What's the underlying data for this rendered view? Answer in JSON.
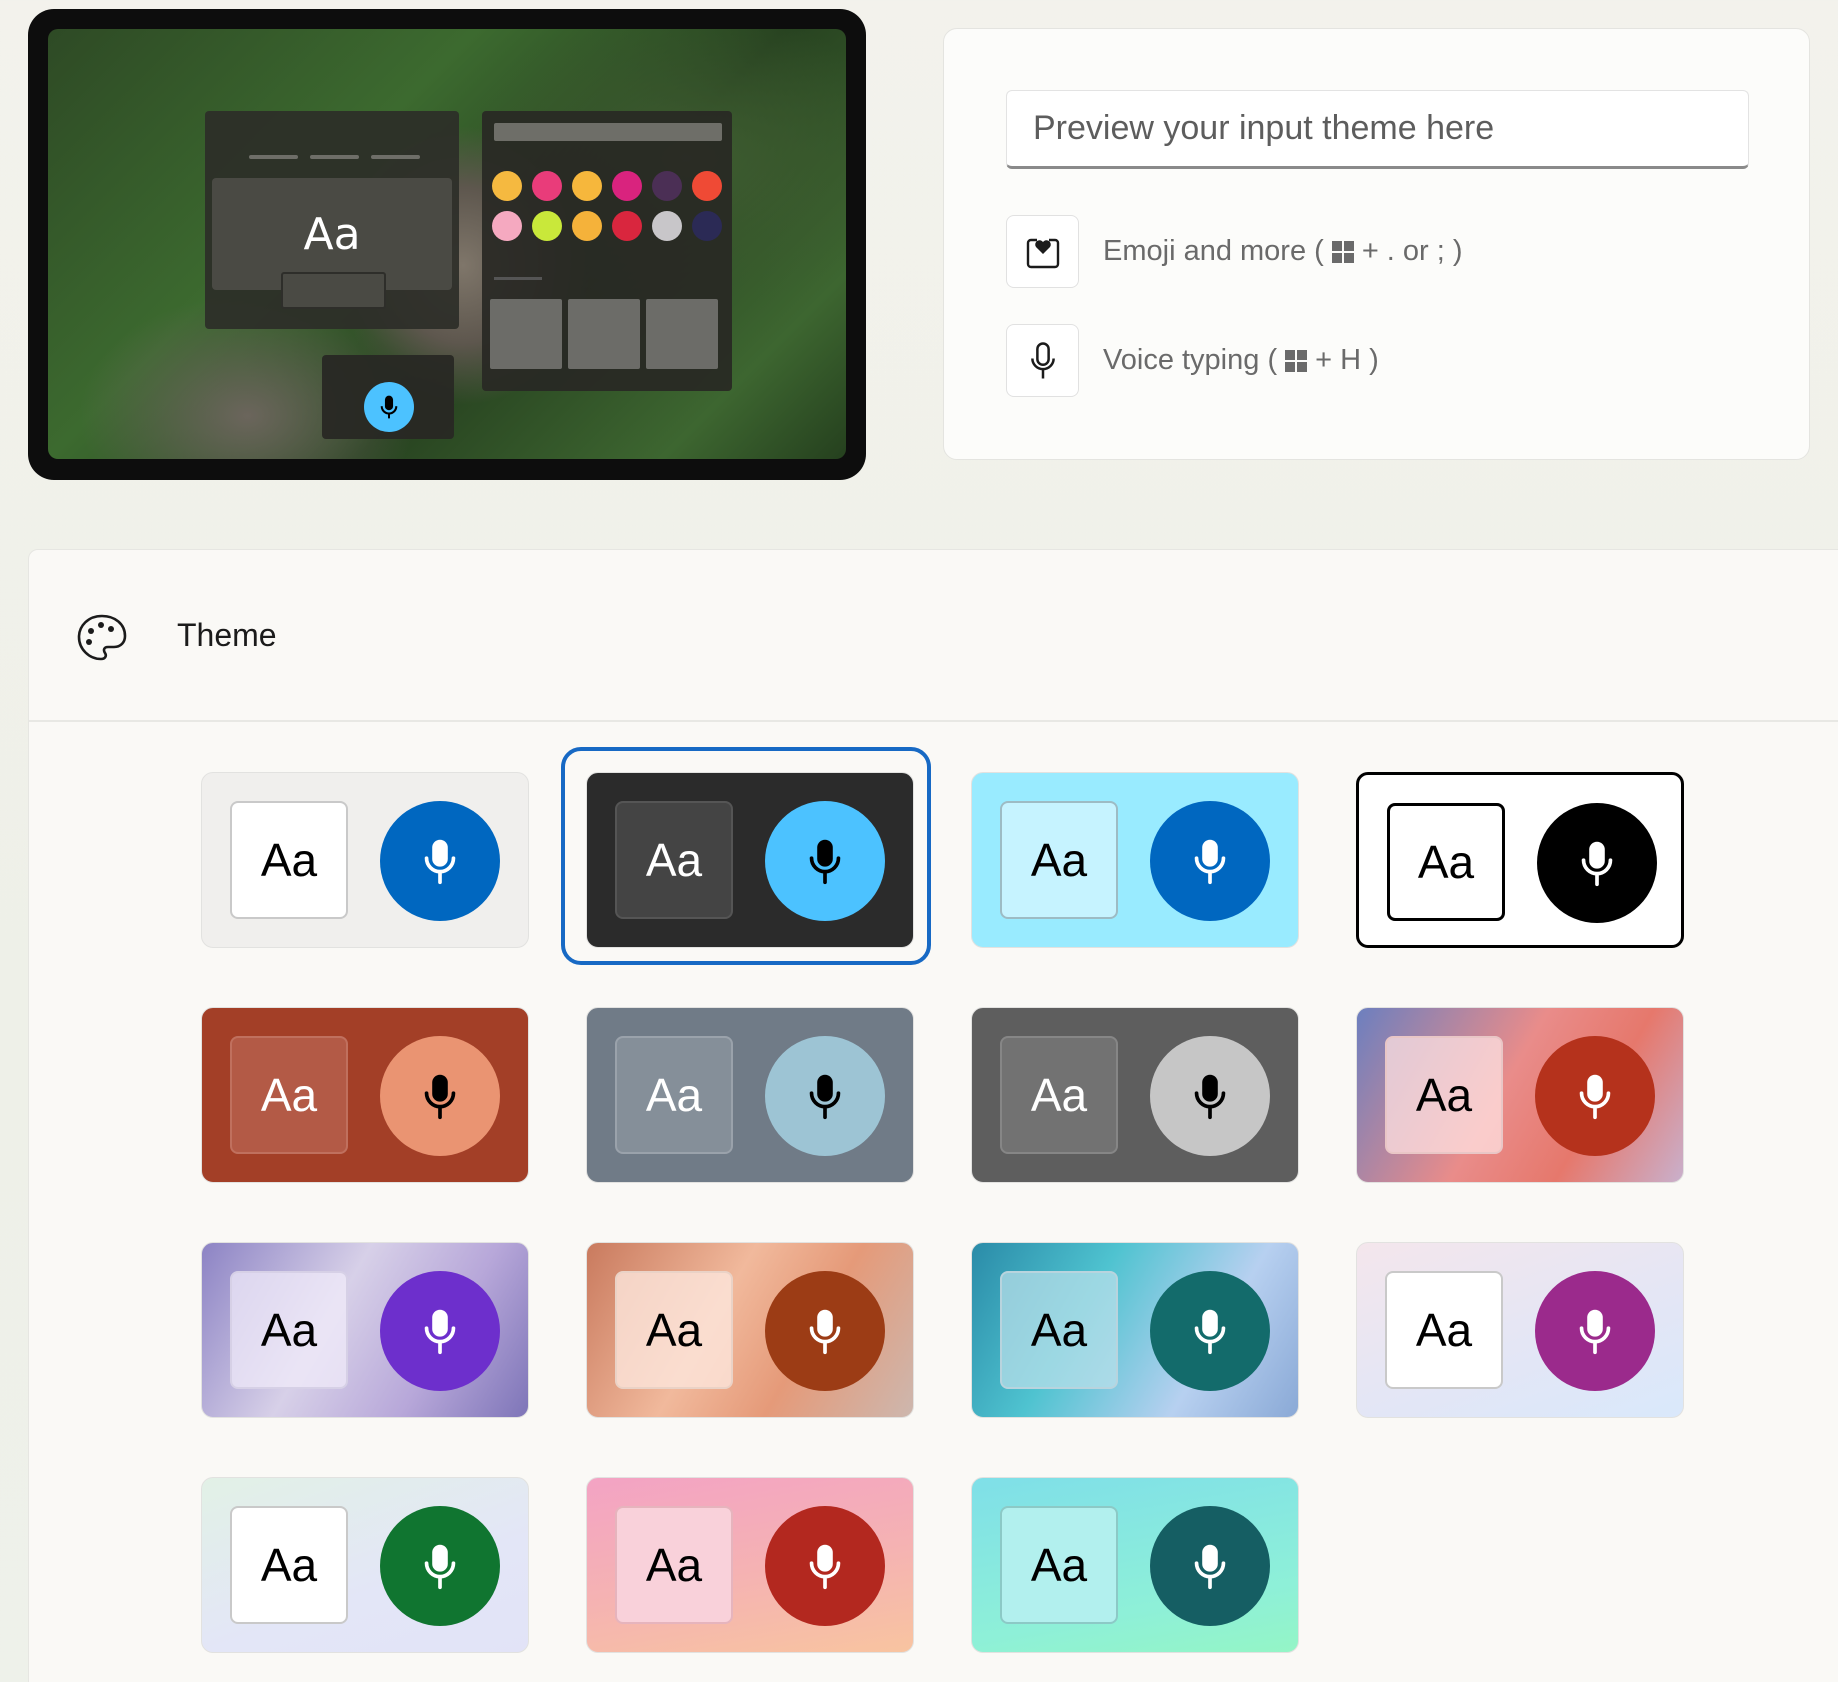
{
  "preview": {
    "input_placeholder": "Preview your input theme here",
    "device_sample_text": "Aa",
    "emoji_dot_colors": [
      "#f5b940",
      "#e93c7a",
      "#f6b73c",
      "#d9237e",
      "#4b2f55",
      "#ef4a35",
      "#f5a9c0",
      "#c9e83a",
      "#f5b23a",
      "#d9263e",
      "#c8c6c9",
      "#2b2a55"
    ],
    "shortcuts": [
      {
        "label_before": "Emoji and more (",
        "label_after": "+ . or ; )",
        "icon": "emoji-heart-icon"
      },
      {
        "label_before": "Voice typing (",
        "label_after": "+ H )",
        "icon": "microphone-icon"
      }
    ]
  },
  "theme": {
    "title": "Theme",
    "icon": "palette-icon",
    "selected_index": 1,
    "tiles": [
      {
        "name": "light",
        "label": "Aa",
        "bg": "#f0efed",
        "key_bg": "#ffffff",
        "key_text": "#000000",
        "key_border": "#c9c9c9",
        "mic_bg": "#0067c0",
        "mic_fg": "#ffffff"
      },
      {
        "name": "dark",
        "label": "Aa",
        "bg": "#2b2b2b",
        "key_bg": "#444444",
        "key_text": "#ffffff",
        "key_border": "#555555",
        "mic_bg": "#4cc2ff",
        "mic_fg": "#000000"
      },
      {
        "name": "aqua",
        "label": "Aa",
        "bg": "#99ebff",
        "key_bg": "#c6f3ff",
        "key_text": "#000000",
        "key_border": "#9dbbc4",
        "mic_bg": "#0067c0",
        "mic_fg": "#ffffff"
      },
      {
        "name": "high-contrast",
        "label": "Aa",
        "bg": "#ffffff",
        "key_bg": "#ffffff",
        "key_text": "#000000",
        "key_border": "#000000",
        "mic_bg": "#000000",
        "mic_fg": "#ffffff"
      },
      {
        "name": "rust",
        "label": "Aa",
        "bg": "#a33f27",
        "key_bg": "#b35a46",
        "key_text": "#ffffff",
        "key_border": "#c0705e",
        "mic_bg": "#ea9472",
        "mic_fg": "#000000"
      },
      {
        "name": "slate",
        "label": "Aa",
        "bg": "#707b87",
        "key_bg": "#858f99",
        "key_text": "#ffffff",
        "key_border": "#9aa2ab",
        "mic_bg": "#9dc4d4",
        "mic_fg": "#000000"
      },
      {
        "name": "graphite",
        "label": "Aa",
        "bg": "#5e5e5e",
        "key_bg": "#727272",
        "key_text": "#ffffff",
        "key_border": "#868686",
        "mic_bg": "#c6c6c6",
        "mic_fg": "#000000"
      },
      {
        "name": "sunset-bloom",
        "label": "Aa",
        "bg": "linear-gradient(120deg,#6c7fbf 0%,#e98c8a 45%,#e6786c 70%,#c9b0cc 100%)",
        "key_bg": "rgba(255,225,225,0.75)",
        "key_text": "#000000",
        "key_border": "#e9c6c6",
        "mic_bg": "#b5321c",
        "mic_fg": "#ffffff"
      },
      {
        "name": "lavender-bloom",
        "label": "Aa",
        "bg": "linear-gradient(120deg,#8c83c4 0%,#d7d0e8 40%,#b7a7d9 70%,#7e75b8 100%)",
        "key_bg": "rgba(240,235,250,0.75)",
        "key_text": "#000000",
        "key_border": "#d6d0e6",
        "mic_bg": "#6d2fcc",
        "mic_fg": "#ffffff"
      },
      {
        "name": "peach-bloom",
        "label": "Aa",
        "bg": "linear-gradient(120deg,#c97a5e 0%,#f1b99c 40%,#e59a79 65%,#cdb7ae 100%)",
        "key_bg": "rgba(252,230,220,0.8)",
        "key_text": "#000000",
        "key_border": "#ead2c6",
        "mic_bg": "#9c3c15",
        "mic_fg": "#ffffff"
      },
      {
        "name": "teal-bloom",
        "label": "Aa",
        "bg": "linear-gradient(120deg,#2a8ba8 0%,#4fc3d0 35%,#b7d0f0 70%,#8aa9d6 100%)",
        "key_bg": "rgba(190,225,235,0.7)",
        "key_text": "#000000",
        "key_border": "#b8d4de",
        "mic_bg": "#136b6b",
        "mic_fg": "#ffffff"
      },
      {
        "name": "orchid",
        "label": "Aa",
        "bg": "linear-gradient(160deg,#f4e6ec 0%,#e4e6f5 55%,#d9e8fb 100%)",
        "key_bg": "#ffffff",
        "key_text": "#000000",
        "key_border": "#c9c9c9",
        "mic_bg": "#9b2a8c",
        "mic_fg": "#ffffff"
      },
      {
        "name": "mint",
        "label": "Aa",
        "bg": "linear-gradient(160deg,#e2f1e6 0%,#e3e6f7 60%,#e2e3f7 100%)",
        "key_bg": "#ffffff",
        "key_text": "#000000",
        "key_border": "#c9c9c9",
        "mic_bg": "#107530",
        "mic_fg": "#ffffff"
      },
      {
        "name": "blush",
        "label": "Aa",
        "bg": "linear-gradient(170deg,#f3a3c4 0%,#f5b3b2 55%,#f8c4a0 100%)",
        "key_bg": "#f9d1da",
        "key_text": "#000000",
        "key_border": "#e6b4bd",
        "mic_bg": "#b3281f",
        "mic_fg": "#ffffff"
      },
      {
        "name": "seafoam",
        "label": "Aa",
        "bg": "linear-gradient(170deg,#7fdfe8 0%,#8ef0d8 70%,#94f5c6 100%)",
        "key_bg": "#b2f0ee",
        "key_text": "#000000",
        "key_border": "#8cc9c6",
        "mic_bg": "#155e63",
        "mic_fg": "#ffffff"
      }
    ]
  }
}
